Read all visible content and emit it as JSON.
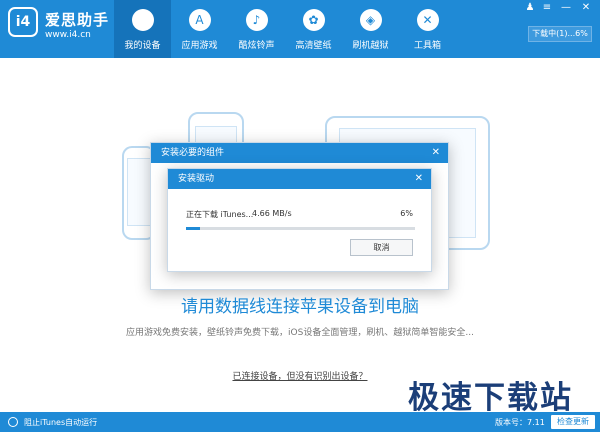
{
  "app": {
    "name": "爱思助手",
    "url": "www.i4.cn",
    "logo_text": "i4"
  },
  "nav": {
    "items": [
      {
        "label": "我的设备",
        "icon": ""
      },
      {
        "label": "应用游戏",
        "icon": "A"
      },
      {
        "label": "酷炫铃声",
        "icon": "♪"
      },
      {
        "label": "高清壁纸",
        "icon": "✿"
      },
      {
        "label": "刷机越狱",
        "icon": "◈"
      },
      {
        "label": "工具箱",
        "icon": "✕"
      }
    ]
  },
  "window_controls": {
    "shirt": "♟",
    "menu": "≡",
    "minimize": "—",
    "close": "✕"
  },
  "download_button": "下载中(1)...6%",
  "main": {
    "headline": "请用数据线连接苹果设备到电脑",
    "subline": "应用游戏免费安装，壁纸铃声免费下载，iOS设备全面管理，刷机、越狱简单智能安全...",
    "link": "已连接设备，但没有识别出设备？"
  },
  "outer_dialog": {
    "title": "安装必要的组件",
    "close": "✕"
  },
  "inner_dialog": {
    "title": "安装驱动",
    "close": "✕",
    "status": "正在下载 iTunes...",
    "speed": "4.66 MB/s",
    "percent_label": "6%",
    "progress": 0.06,
    "cancel": "取消"
  },
  "watermark": "极速下载站",
  "statusbar": {
    "stop_label": "阻止iTunes自动运行",
    "version": "版本号：7.11",
    "check_update": "检查更新"
  },
  "colors": {
    "primary": "#1f8ad6",
    "active_nav": "#1573ba"
  }
}
